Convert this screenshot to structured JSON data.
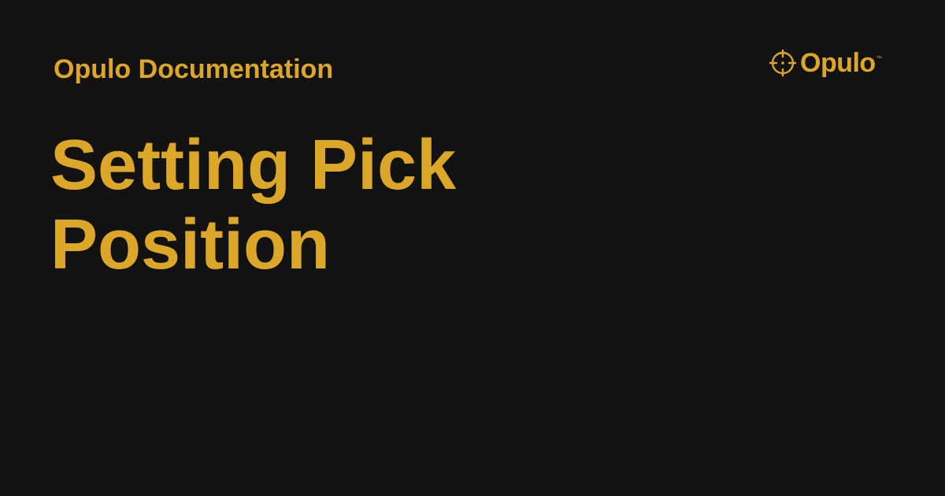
{
  "site": {
    "name": "Opulo Documentation"
  },
  "page": {
    "title_line_1": "Setting Pick",
    "title_line_2": "Position"
  },
  "logo": {
    "icon": "crosshair-icon",
    "wordmark": "Opulo",
    "trademark": "™"
  },
  "colors": {
    "background": "#121212",
    "accent": "#dca728"
  }
}
